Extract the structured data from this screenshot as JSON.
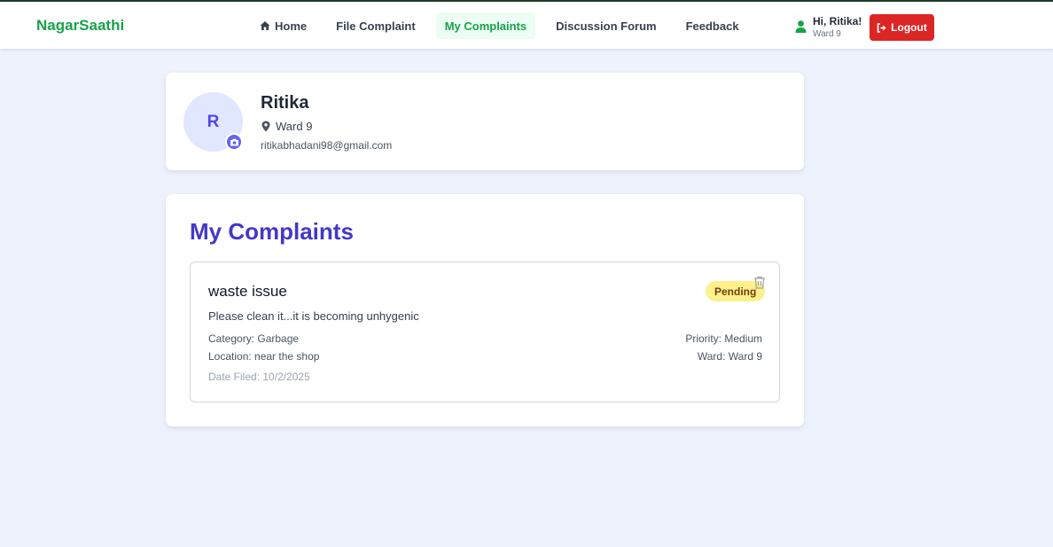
{
  "brand": "NagarSaathi",
  "nav": [
    {
      "label": "Home",
      "icon": "home-icon",
      "active": false
    },
    {
      "label": "File Complaint",
      "active": false
    },
    {
      "label": "My Complaints",
      "active": true
    },
    {
      "label": "Discussion Forum",
      "active": false
    },
    {
      "label": "Feedback",
      "active": false
    }
  ],
  "user": {
    "greeting": "Hi, Ritika!",
    "ward": "Ward 9",
    "icon": "user-icon"
  },
  "logout_label": "Logout",
  "profile": {
    "initial": "R",
    "name": "Ritika",
    "ward": "Ward 9",
    "email": "ritikabhadani98@gmail.com"
  },
  "complaints_section": {
    "title": "My Complaints",
    "items": [
      {
        "title": "waste issue",
        "description": "Please clean it...it is becoming unhygenic",
        "status": "Pending",
        "category": "Category: Garbage",
        "location": "Location: near the shop",
        "priority": "Priority: Medium",
        "ward": "Ward: Ward 9",
        "date": "Date Filed: 10/2/2025"
      }
    ]
  },
  "colors": {
    "brand": "#16a34a",
    "accent": "#4338ca",
    "logout": "#dc2626",
    "pending_badge": "#fef08a",
    "background": "#eef2fc"
  }
}
